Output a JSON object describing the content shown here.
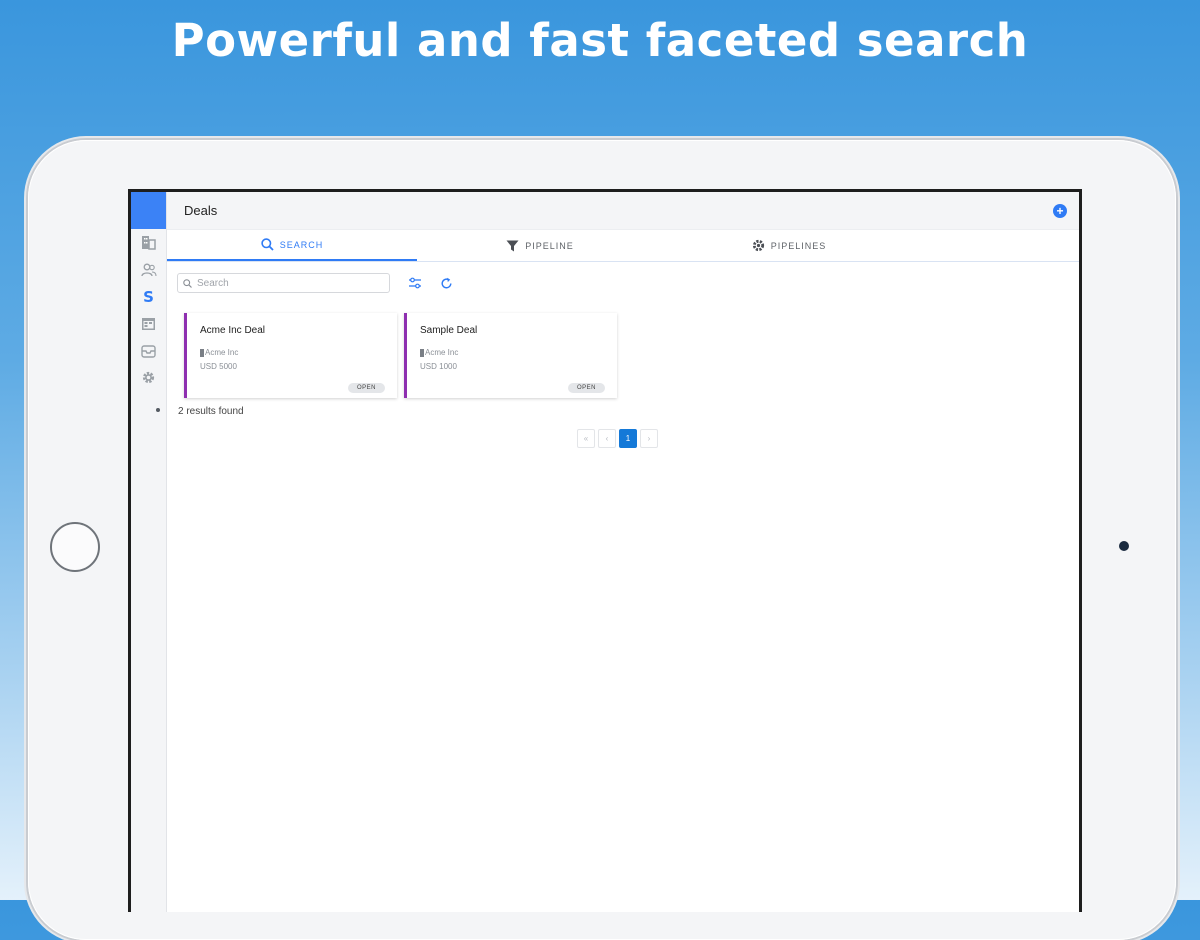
{
  "headline": "Powerful and fast faceted search",
  "app": {
    "page_title": "Deals",
    "add_button": "+",
    "sidebar": {
      "items": [
        {
          "name": "building-icon",
          "active": false
        },
        {
          "name": "contacts-icon",
          "active": false
        },
        {
          "name": "deals-icon",
          "active": true
        },
        {
          "name": "calendar-icon",
          "active": false
        },
        {
          "name": "inbox-icon",
          "active": false
        },
        {
          "name": "gear-icon",
          "active": false
        }
      ],
      "deals_glyph": "S"
    },
    "tabs": [
      {
        "label": "SEARCH",
        "icon": "search-icon",
        "active": true
      },
      {
        "label": "PIPELINE",
        "icon": "funnel-icon",
        "active": false
      },
      {
        "label": "PIPELINES",
        "icon": "gear-icon",
        "active": false
      }
    ],
    "search": {
      "placeholder": "Search",
      "value": ""
    },
    "deals": [
      {
        "title": "Acme Inc Deal",
        "company": "Acme Inc",
        "amount": "USD 5000",
        "status": "OPEN"
      },
      {
        "title": "Sample Deal",
        "company": "Acme Inc",
        "amount": "USD 1000",
        "status": "OPEN"
      }
    ],
    "results_text": "2 results found",
    "pagination": {
      "first": "«",
      "prev": "‹",
      "current": "1",
      "next": "›"
    },
    "colors": {
      "accent": "#2f7bf5",
      "card_stripe": "#8e2fb0",
      "current_page": "#1479d8"
    }
  }
}
